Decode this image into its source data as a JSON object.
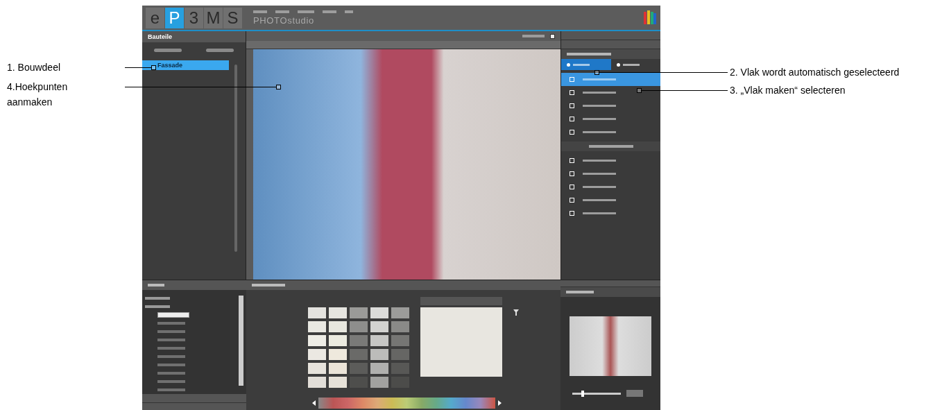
{
  "logo": {
    "letters": [
      {
        "text": "e",
        "selected": false
      },
      {
        "text": "P",
        "selected": true
      },
      {
        "text": "3",
        "selected": false
      },
      {
        "text": "M",
        "selected": false
      },
      {
        "text": "S",
        "selected": false
      }
    ],
    "product": "PHOTOstudio"
  },
  "left_panel": {
    "title": "Bauteile",
    "tree": [
      {
        "label": "Fassade",
        "selected": true
      }
    ]
  },
  "canvas": {
    "option_checkbox": {
      "checked": true
    }
  },
  "right_panel": {
    "modes": [
      {
        "selected": true
      },
      {
        "selected": false
      }
    ],
    "tools": [
      {
        "selected": true
      },
      {
        "selected": false
      },
      {
        "selected": false
      },
      {
        "selected": false
      },
      {
        "selected": false
      }
    ],
    "extra_tools": [
      {
        "selected": false
      },
      {
        "selected": false
      },
      {
        "selected": false
      },
      {
        "selected": false
      },
      {
        "selected": false
      }
    ]
  },
  "color_tree": {
    "items": [
      {
        "selected": false
      },
      {
        "selected": false
      },
      {
        "selected": true
      },
      {
        "selected": false
      },
      {
        "selected": false
      },
      {
        "selected": false
      },
      {
        "selected": false
      },
      {
        "selected": false
      },
      {
        "selected": false
      },
      {
        "selected": false
      },
      {
        "selected": false
      },
      {
        "selected": false
      }
    ]
  },
  "swatches": [
    {
      "color": "#e4e3df"
    },
    {
      "color": "#e6e5e0"
    },
    {
      "color": "#9a9a98"
    },
    {
      "color": "#dcdcda"
    },
    {
      "color": "#9c9c9a"
    },
    {
      "color": "#e9e8e2"
    },
    {
      "color": "#e8e7df"
    },
    {
      "color": "#8e8e8c"
    },
    {
      "color": "#d2d2d0"
    },
    {
      "color": "#8a8a88"
    },
    {
      "color": "#eeede6"
    },
    {
      "color": "#ecebe0"
    },
    {
      "color": "#7a7a78"
    },
    {
      "color": "#c6c6c4"
    },
    {
      "color": "#767674"
    },
    {
      "color": "#ebe8e2"
    },
    {
      "color": "#efe9dd"
    },
    {
      "color": "#6a6a68"
    },
    {
      "color": "#bcbcba"
    },
    {
      "color": "#666664"
    },
    {
      "color": "#e7e3dc"
    },
    {
      "color": "#ebe4d8"
    },
    {
      "color": "#5c5c5a"
    },
    {
      "color": "#b0b0ae"
    },
    {
      "color": "#585856"
    },
    {
      "color": "#e2ded8"
    },
    {
      "color": "#e6e1d8"
    },
    {
      "color": "#4e4e4c"
    },
    {
      "color": "#a2a2a0"
    },
    {
      "color": "#4c4c4a"
    }
  ],
  "preview": {
    "color": "#e8e6e0",
    "zoom": {
      "level": 0.2
    }
  },
  "annotations": [
    {
      "text": "1. Bouwdeel",
      "kind": "left"
    },
    {
      "text": "4.Hoekpunten aanmaken",
      "kind": "left"
    },
    {
      "text": "2. Vlak wordt automatisch geselecteerd",
      "kind": "right"
    },
    {
      "text": "3. „Vlak maken“ selecteren",
      "kind": "right"
    }
  ]
}
